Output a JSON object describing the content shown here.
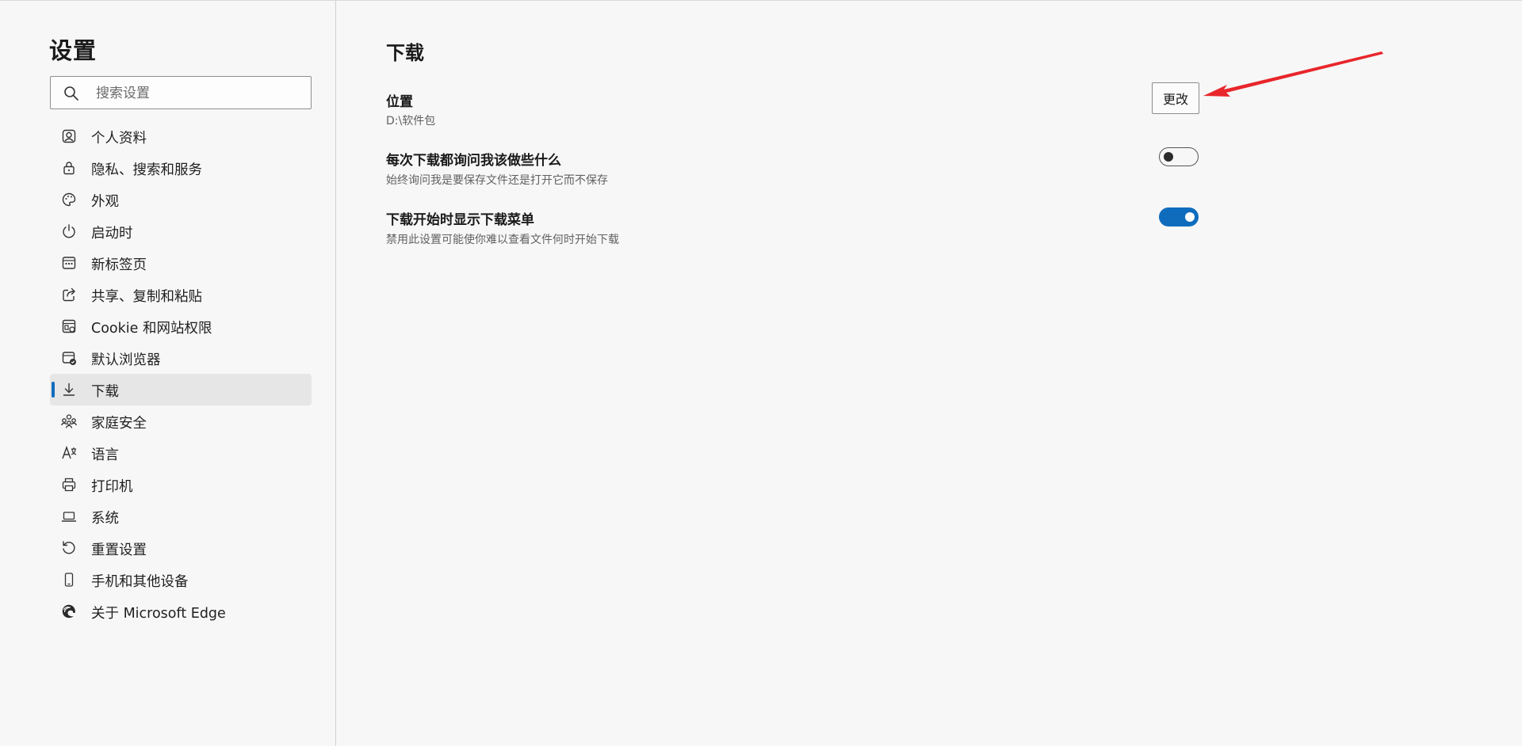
{
  "sidebar": {
    "title": "设置",
    "search": {
      "placeholder": "搜索设置",
      "value": ""
    },
    "items": [
      {
        "label": "个人资料",
        "icon": "profile-icon"
      },
      {
        "label": "隐私、搜索和服务",
        "icon": "lock-icon"
      },
      {
        "label": "外观",
        "icon": "palette-icon"
      },
      {
        "label": "启动时",
        "icon": "power-icon"
      },
      {
        "label": "新标签页",
        "icon": "new-tab-icon"
      },
      {
        "label": "共享、复制和粘贴",
        "icon": "share-icon"
      },
      {
        "label": "Cookie 和网站权限",
        "icon": "site-permissions-icon"
      },
      {
        "label": "默认浏览器",
        "icon": "default-browser-icon"
      },
      {
        "label": "下载",
        "icon": "download-icon",
        "active": true
      },
      {
        "label": "家庭安全",
        "icon": "family-icon"
      },
      {
        "label": "语言",
        "icon": "language-icon"
      },
      {
        "label": "打印机",
        "icon": "printer-icon"
      },
      {
        "label": "系统",
        "icon": "laptop-icon"
      },
      {
        "label": "重置设置",
        "icon": "reset-icon"
      },
      {
        "label": "手机和其他设备",
        "icon": "phone-icon"
      },
      {
        "label": "关于 Microsoft Edge",
        "icon": "edge-logo-icon"
      }
    ]
  },
  "main": {
    "title": "下载",
    "location": {
      "title": "位置",
      "value": "D:\\软件包",
      "button_label": "更改"
    },
    "ask_each_time": {
      "title": "每次下载都询问我该做些什么",
      "desc": "始终询问我是要保存文件还是打开它而不保存",
      "enabled": false
    },
    "show_menu": {
      "title": "下载开始时显示下载菜单",
      "desc": "禁用此设置可能使你难以查看文件何时开始下载",
      "enabled": true
    }
  },
  "colors": {
    "accent": "#0f6cbd",
    "annotation_arrow": "#e8262b",
    "background": "#f7f7f7"
  }
}
